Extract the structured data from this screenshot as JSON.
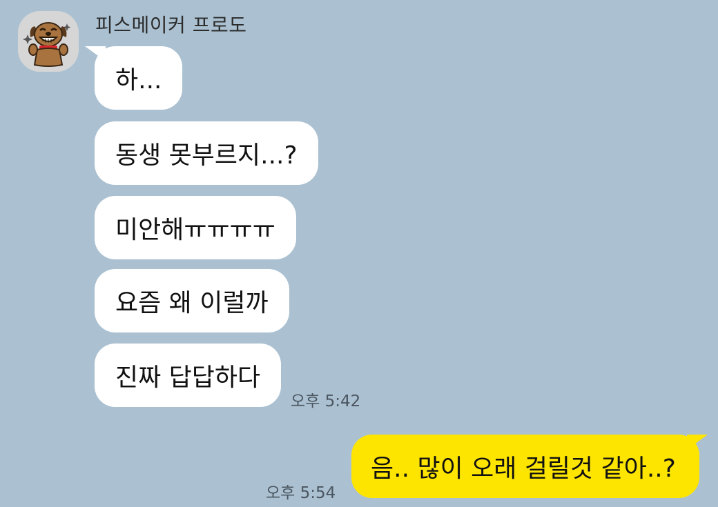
{
  "chat": {
    "sender_name": "피스메이커 프로도",
    "avatar_icon": "frodo-dog-avatar-icon",
    "incoming_messages": [
      "하...",
      "동생 못부르지...?",
      "미안해ㅠㅠㅠㅠ",
      "요즘 왜 이럴까",
      "진짜 답답하다"
    ],
    "incoming_time": "오후 5:42",
    "outgoing_message": "음.. 많이 오래 걸릴것 같아..?",
    "outgoing_time": "오후 5:54"
  },
  "colors": {
    "background": "#abc1d1",
    "incoming_bubble": "#ffffff",
    "outgoing_bubble": "#fee500",
    "timestamp_text": "#4a5560"
  }
}
